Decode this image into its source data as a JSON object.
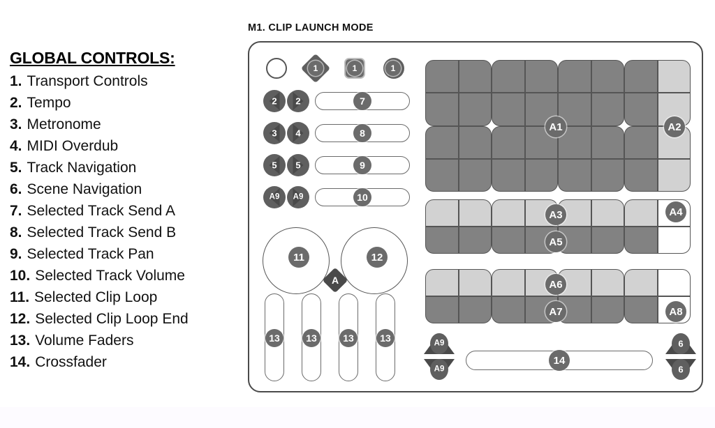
{
  "legend": {
    "title": "GLOBAL CONTROLS:",
    "items": [
      {
        "num": "1.",
        "label": "Transport Controls"
      },
      {
        "num": "2.",
        "label": "Tempo"
      },
      {
        "num": "3.",
        "label": "Metronome"
      },
      {
        "num": "4.",
        "label": "MIDI Overdub"
      },
      {
        "num": "5.",
        "label": "Track Navigation"
      },
      {
        "num": "6.",
        "label": "Scene Navigation"
      },
      {
        "num": "7.",
        "label": "Selected Track Send A"
      },
      {
        "num": "8.",
        "label": "Selected Track Send B"
      },
      {
        "num": "9.",
        "label": "Selected Track Pan"
      },
      {
        "num": "10.",
        "label": "Selected Track Volume"
      },
      {
        "num": "11.",
        "label": "Selected Clip Loop"
      },
      {
        "num": "12.",
        "label": "Selected Clip Loop End"
      },
      {
        "num": "13.",
        "label": "Volume Faders"
      },
      {
        "num": "14.",
        "label": "Crossfader"
      }
    ]
  },
  "mode": {
    "title": "M1. CLIP LAUNCH MODE"
  },
  "device": {
    "transport": {
      "blank_knob": "",
      "record_label": "1",
      "stop_label": "1",
      "play_label": "1"
    },
    "nav_rows": [
      {
        "left": "2",
        "right": "2",
        "slider": "7"
      },
      {
        "left": "3",
        "right": "4",
        "slider": "8"
      },
      {
        "left": "5",
        "right": "5",
        "slider": "9"
      },
      {
        "left": "A9",
        "right": "A9",
        "slider": "10"
      }
    ],
    "knobs": [
      {
        "label": "11"
      },
      {
        "label": "12"
      }
    ],
    "knob_divider_label": "A",
    "faders": [
      "13",
      "13",
      "13",
      "13"
    ],
    "crossfader_label": "14",
    "crossfader_left_up": "A9",
    "crossfader_left_down": "A9",
    "crossfader_right_up": "6",
    "crossfader_right_down": "6",
    "grid_badges": {
      "top_center": "A1",
      "top_right": "A2",
      "mid_upper": "A3",
      "mid_right": "A4",
      "mid_lower": "A5",
      "bot_upper": "A6",
      "bot_lower": "A7",
      "bot_right": "A8"
    }
  },
  "colors": {
    "pad_dark": "#828282",
    "pad_light": "#d2d2d2",
    "pad_mid": "#8a8a8a",
    "pad_white": "#ffffff",
    "badge": "#6b6b6b",
    "badge_dark": "#3f3f3f",
    "outline": "#4a4a4a"
  }
}
